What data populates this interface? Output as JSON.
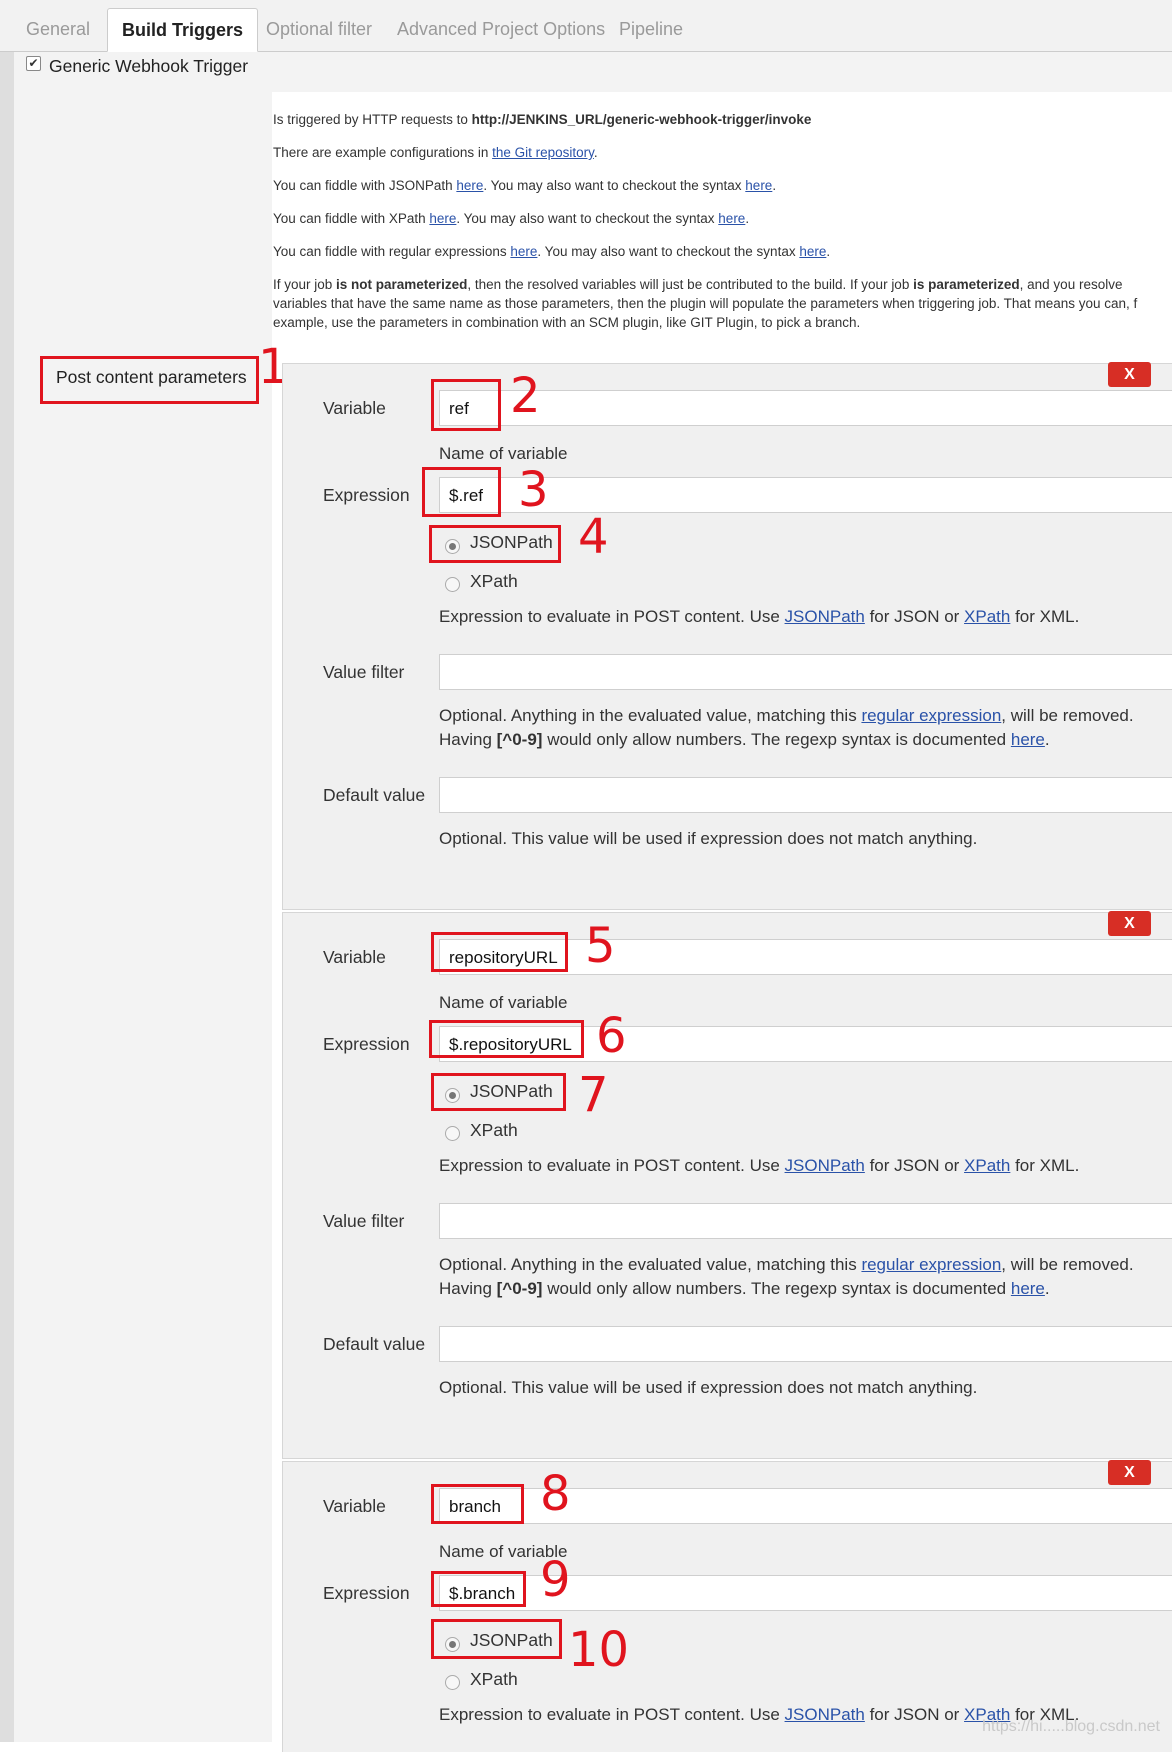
{
  "tabs": [
    {
      "label": "General"
    },
    {
      "label": "Build Triggers"
    },
    {
      "label": "Optional filter"
    },
    {
      "label": "Advanced Project Options"
    },
    {
      "label": "Pipeline"
    }
  ],
  "trigger": {
    "label": "Generic Webhook Trigger",
    "checked": true
  },
  "help": {
    "l1_pre": "Is triggered by HTTP requests to ",
    "l1_url": "http://JENKINS_URL/generic-webhook-trigger/invoke",
    "l2_pre": "There are example configurations in ",
    "l2_link": "the Git repository",
    "l2_post": ".",
    "l3_pre": "You can fiddle with JSONPath ",
    "l3_mid": ". You may also want to checkout the syntax ",
    "l4_pre": "You can fiddle with XPath ",
    "l4_mid": ". You may also want to checkout the syntax ",
    "l5_pre": "You can fiddle with regular expressions ",
    "l5_mid": ". You may also want to checkout the syntax ",
    "here": "here",
    "dot": ".",
    "p_a": "If your job ",
    "p_b": "is not parameterized",
    "p_c": ", then the resolved variables will just be contributed to the build. If your job ",
    "p_d": "is parameterized",
    "p_e": ", and you resolve",
    "p_line2": "variables that have the same name as those parameters, then the plugin will populate the parameters when triggering job. That means you can, f",
    "p_line3": "example, use the parameters in combination with an SCM plugin, like GIT Plugin, to pick a branch."
  },
  "section_label": "Post content parameters",
  "labels": {
    "variable": "Variable",
    "name_hint": "Name of variable",
    "expression": "Expression",
    "jsonpath": "JSONPath",
    "xpath": "XPath",
    "expr_hint_pre": "Expression to evaluate in POST content. Use ",
    "expr_hint_jsonpath": "JSONPath",
    "expr_hint_mid": " for JSON or ",
    "expr_hint_xpath": "XPath",
    "expr_hint_post": " for XML.",
    "value_filter": "Value filter",
    "vf_hint1_pre": "Optional. Anything in the evaluated value, matching this ",
    "vf_hint1_link": "regular expression",
    "vf_hint1_post": ", will be removed.",
    "vf_hint2_pre": "Having ",
    "vf_hint2_bold": "[^0-9]",
    "vf_hint2_mid": " would only allow numbers. The regexp syntax is documented ",
    "vf_hint2_link": "here",
    "vf_hint2_post": ".",
    "default_value": "Default value",
    "dv_hint": "Optional. This value will be used if expression does not match anything.",
    "delete": "X"
  },
  "params": [
    {
      "variable": "ref",
      "expression": "$.ref",
      "type": "JSONPath",
      "value_filter": "",
      "default_value": ""
    },
    {
      "variable": "repositoryURL",
      "expression": "$.repositoryURL",
      "type": "JSONPath",
      "value_filter": "",
      "default_value": ""
    },
    {
      "variable": "branch",
      "expression": "$.branch",
      "type": "JSONPath"
    }
  ],
  "annotations": [
    "1",
    "2",
    "3",
    "4",
    "5",
    "6",
    "7",
    "8",
    "9",
    "10"
  ],
  "watermark": "https://hi.....blog.csdn.net",
  "colors": {
    "annotation": "#e0141e",
    "delete_button": "#d72e25",
    "link": "#2a52a8"
  }
}
